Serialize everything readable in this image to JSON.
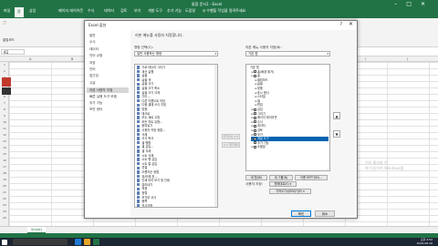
{
  "excel": {
    "title": "통합 문서1 - Excel",
    "tabs": [
      "파일",
      "홈",
      "삽입",
      "페이지 레이아웃",
      "수식",
      "데이터",
      "검토",
      "보기",
      "개발 도구",
      "추가 기능",
      "도움말"
    ],
    "tell_me": "♀ 수행할 작업을 알려주세요",
    "clipboard": "클립보드",
    "name_box": "A1",
    "columns": [
      "A",
      "B",
      "C",
      "D",
      "E",
      "F",
      "G",
      "H",
      "I",
      "J"
    ],
    "rows": [
      "1",
      "2",
      "3",
      "4",
      "5",
      "6",
      "7",
      "8",
      "9",
      "10",
      "11",
      "12",
      "13",
      "14",
      "15",
      "16",
      "17",
      "18",
      "19",
      "20",
      "21",
      "22",
      "23",
      "24",
      "25"
    ],
    "sheet_tab": "Sheet1"
  },
  "taskbar": {
    "time": "오후 4:52",
    "date": "2019-08-16"
  },
  "dialog": {
    "title": "Excel 옵션",
    "help": "?",
    "close": "✕",
    "nav": [
      "일반",
      "수식",
      "데이터",
      "언어 교정",
      "저장",
      "언어",
      "접근성",
      "고급",
      "리본 사용자 지정",
      "빠른 실행 도구 모음",
      "추가 기능",
      "보안 센터"
    ],
    "nav_active_index": 8,
    "heading": "리본 메뉴를 사용자 지정합니다.",
    "choose_label": "명령 선택(C):",
    "choose_value": "일반 사용하는 명령",
    "customize_label": "리본 메뉴 사용자 지정(B):",
    "customize_value": "기본 탭",
    "commands": [
      "가로 테두리 그리기",
      "계산 실행",
      "글꼴",
      "글꼴 색",
      "글꼴 크기",
      "글꼴 크기 축소",
      "글꼴 크기 크게",
      "기타 ...",
      "다른 이름으로 저장",
      "다음 셀에 서식 지정",
      "맞춤",
      "매크로",
      "모두 새로 고침",
      "모든 차트 유형...",
      "붙여넣기",
      "사용자 지정 정렬...",
      "삭제",
      "서식 복사",
      "셀 병합",
      "셀 삽입...",
      "셀 삭제",
      "시트 삭제",
      "시트 행 삽입",
      "시트 열 삽입",
      "연결",
      "오름차순 정렬",
      "위/아래 표 ...",
      "인쇄 미리 보기 및 인쇄",
      "잘라내기",
      "적용",
      "정렬",
      "조건부 서식",
      "중복",
      "직사각형",
      "채우기 색",
      "테두리",
      "틀 고정",
      "표",
      "필터",
      "필터 추가 또는 제거",
      "하이퍼링크",
      "합계",
      "행 높이",
      "확대",
      "확대/축소",
      "화면 분할",
      "피벗 테이블"
    ],
    "add_button": "추가(A) >>",
    "remove_button": "<< 제거(R)",
    "tree": [
      {
        "label": "기본 탭",
        "indent": 0,
        "expander": "",
        "checkbox": false
      },
      {
        "label": "홈(배경 제거)",
        "indent": 1,
        "expander": "⊞",
        "checkbox": true
      },
      {
        "label": "홈",
        "indent": 1,
        "expander": "⊟",
        "checkbox": true
      },
      {
        "label": "클립보드",
        "indent": 2,
        "expander": "⊞",
        "checkbox": false
      },
      {
        "label": "글꼴",
        "indent": 2,
        "expander": "⊞",
        "checkbox": false
      },
      {
        "label": "맞춤",
        "indent": 2,
        "expander": "⊞",
        "checkbox": false
      },
      {
        "label": "표시 형식",
        "indent": 2,
        "expander": "⊞",
        "checkbox": false
      },
      {
        "label": "스타일",
        "indent": 2,
        "expander": "⊞",
        "checkbox": false
      },
      {
        "label": "셀",
        "indent": 2,
        "expander": "⊞",
        "checkbox": false
      },
      {
        "label": "편집",
        "indent": 2,
        "expander": "⊞",
        "checkbox": false
      },
      {
        "label": "삽입",
        "indent": 1,
        "expander": "⊞",
        "checkbox": true
      },
      {
        "label": "그리기",
        "indent": 1,
        "expander": "⊞",
        "checkbox": true
      },
      {
        "label": "페이지 레이아웃",
        "indent": 1,
        "expander": "⊞",
        "checkbox": true
      },
      {
        "label": "수식",
        "indent": 1,
        "expander": "⊞",
        "checkbox": true
      },
      {
        "label": "데이터",
        "indent": 1,
        "expander": "⊞",
        "checkbox": true
      },
      {
        "label": "검토",
        "indent": 1,
        "expander": "⊞",
        "checkbox": true
      },
      {
        "label": "보기",
        "indent": 1,
        "expander": "⊞",
        "checkbox": true
      },
      {
        "label": "개발 도구",
        "indent": 1,
        "expander": "⊞",
        "checkbox": true,
        "selected": true
      },
      {
        "label": "추가 기능",
        "indent": 1,
        "expander": "",
        "checkbox": true
      },
      {
        "label": "도움말",
        "indent": 1,
        "expander": "⊞",
        "checkbox": true
      }
    ],
    "new_tab": "새 탭(W)",
    "new_group": "새 그룹(N)",
    "rename": "이름 바꾸기(M)...",
    "customizations_label": "사용자 지정:",
    "reset_label": "원래대로(E) ▾",
    "import_export": "가져오기/내보내기(P) ▾",
    "ok": "확인",
    "cancel": "취소"
  },
  "ghost_text": [
    "이미 활성화 된",
    "에 이동하여 Windows를"
  ]
}
